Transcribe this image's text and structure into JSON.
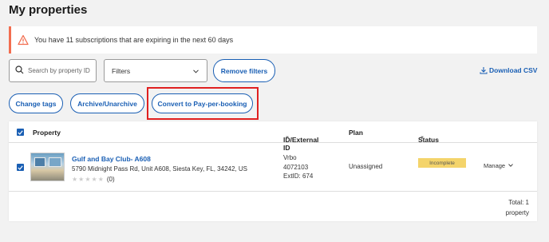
{
  "page": {
    "title": "My properties"
  },
  "alert": {
    "text": "You have 11 subscriptions that are expiring in the next 60 days",
    "color": "#f26d4f"
  },
  "toolbar": {
    "search_placeholder": "Search by property ID",
    "filters_label": "Filters",
    "remove_filters": "Remove filters",
    "download_csv": "Download CSV",
    "change_tags": "Change tags",
    "archive": "Archive/Unarchive",
    "convert": "Convert to Pay-per-booking"
  },
  "table": {
    "headers": {
      "property": "Property",
      "id": "ID/External ID",
      "plan": "Plan",
      "status": "Status"
    },
    "rows": [
      {
        "name": "Gulf and Bay Club- A608",
        "address": "5790 Midnight Pass Rd, Unit A608, Siesta Key, FL, 34242, US",
        "rating_count": "(0)",
        "source": "Vrbo",
        "id": "4072103",
        "ext_id": "ExtID: 674",
        "plan": "Unassigned",
        "status": "Incomplete",
        "manage": "Manage"
      }
    ],
    "total_line1": "Total: 1",
    "total_line2": "property"
  },
  "colors": {
    "accent": "#1a5fb4",
    "status_incomplete": "#f4d46b",
    "highlight": "#e02020"
  }
}
